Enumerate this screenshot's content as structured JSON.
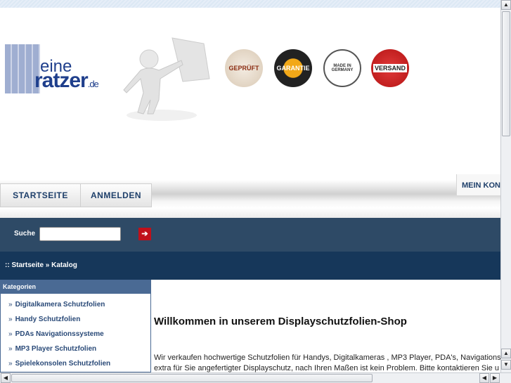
{
  "logo": {
    "text_line1": "eine",
    "text_line2": "ratzer",
    "tld": ".de"
  },
  "badges": [
    "GEPRÜFT",
    "GARANTIE",
    "MADE IN GERMANY",
    "VERSAND"
  ],
  "nav": {
    "tabs": [
      "STARTSEITE",
      "ANMELDEN"
    ],
    "account": "MEIN KON"
  },
  "search": {
    "label": "Suche",
    "value": "",
    "go_icon": "arrow-right-icon"
  },
  "breadcrumb": {
    "text": ":: Startseite » Katalog"
  },
  "categories": {
    "title": "Kategorien",
    "items": [
      "Digitalkamera Schutzfolien",
      "Handy Schutzfolien",
      "PDAs Navigationssysteme",
      "MP3 Player Schutzfolien",
      "Spielekonsolen Schutzfolien"
    ]
  },
  "main": {
    "heading": "Willkommen in unserem Displayschutzfolien-Shop",
    "line1": "Wir verkaufen hochwertige Schutzfolien für Handys, Digitalkameras , MP3 Player, PDA's, Navigations",
    "line2": "extra für Sie angefertigter Displayschutz, nach Ihren Maßen ist kein Problem. Bitte kontaktieren Sie u"
  },
  "colors": {
    "nav_dark": "#16375a",
    "search_bar": "#2e4a66",
    "accent_red": "#c0101a"
  }
}
